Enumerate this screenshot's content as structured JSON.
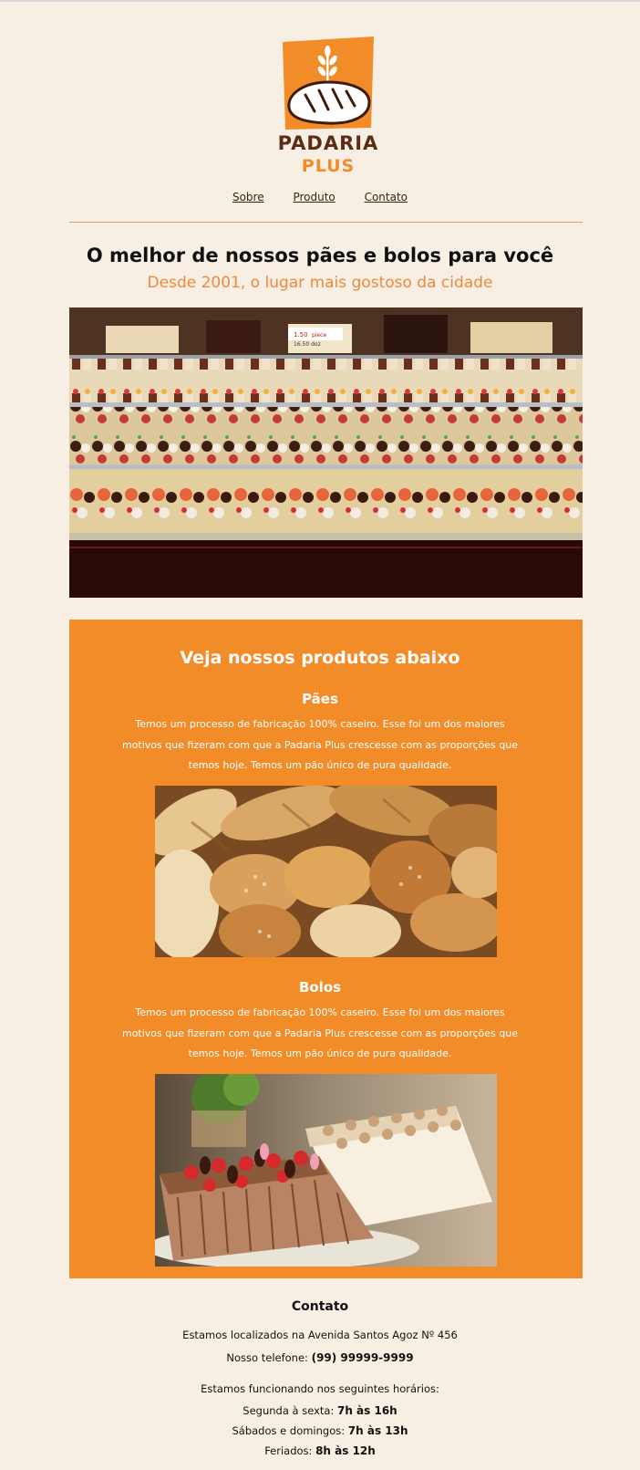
{
  "brand": {
    "line1": "PADARIA",
    "line2": "PLUS"
  },
  "nav": {
    "items": [
      "Sobre",
      "Produto",
      "Contato"
    ]
  },
  "hero": {
    "title": "O melhor de nossos pães e bolos para você",
    "subtitle": "Desde 2001, o lugar mais gostoso da cidade",
    "price_tag_1": "1.50",
    "price_tag_2": "piece",
    "price_tag_3": "16.50 doz"
  },
  "products": {
    "title": "Veja nossos produtos abaixo",
    "categories": [
      {
        "name": "Pães",
        "description": "Temos um processo de fabricação 100% caseiro. Esse foi um dos maiores motivos que fizeram com que a Padaria Plus crescesse com as proporções que temos hoje. Temos um pão único de pura qualidade."
      },
      {
        "name": "Bolos",
        "description": "Temos um processo de fabricação 100% caseiro. Esse foi um dos maiores motivos que fizeram com que a Padaria Plus crescesse com as proporções que temos hoje. Temos um pão único de pura qualidade."
      }
    ]
  },
  "contact": {
    "title": "Contato",
    "address": "Estamos localizados na Avenida Santos Agoz Nº 456",
    "phone_label": "Nosso telefone: ",
    "phone": "(99) 99999-9999",
    "hours_intro": "Estamos funcionando nos seguintes horários:",
    "hours": [
      {
        "label": "Segunda à sexta: ",
        "value": "7h às 16h"
      },
      {
        "label": "Sábados e domingos: ",
        "value": "7h às 13h"
      },
      {
        "label": "Feriados: ",
        "value": "8h às 12h"
      }
    ]
  },
  "colors": {
    "accent": "#f28c28",
    "background": "#f7efe4",
    "brand_dark": "#5a2d14",
    "divider": "#e4a05a"
  }
}
